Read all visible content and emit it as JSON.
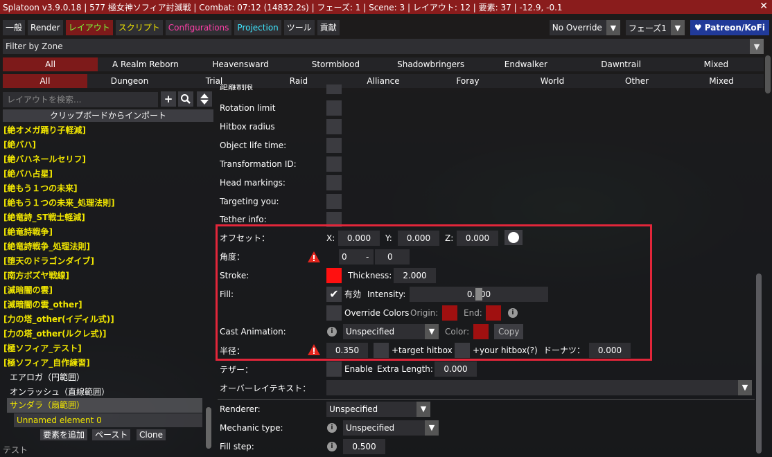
{
  "title": "Splatoon v3.9.0.18 | 577 極女神ソフィア討滅戦 | Combat: 07:12 (14832.2s) | フェーズ: 1 | Scene: 3 | レイアウト: 12 | 要素: 37 | -12.9, -0.1",
  "tabs": [
    {
      "label": "一般",
      "color": "#ffffff"
    },
    {
      "label": "Render",
      "color": "#ffffff"
    },
    {
      "label": "レイアウト",
      "color": "#7dff3a"
    },
    {
      "label": "スクリプト",
      "color": "#f1e600"
    },
    {
      "label": "Configurations",
      "color": "#ff3fa8"
    },
    {
      "label": "Projection",
      "color": "#3fe6ff"
    },
    {
      "label": "ツール",
      "color": "#ffffff"
    },
    {
      "label": "貢献",
      "color": "#ffffff"
    }
  ],
  "controls": {
    "override": "No Override",
    "phase": "フェーズ1",
    "patreon": "♥ Patreon/KoFi"
  },
  "filter": "Filter by Zone",
  "expansions": [
    "All",
    "A Realm Reborn",
    "Heavensward",
    "Stormblood",
    "Shadowbringers",
    "Endwalker",
    "Dawntrail",
    "Mixed"
  ],
  "content_types": [
    "All",
    "Dungeon",
    "Trial",
    "Raid",
    "Alliance",
    "Foray",
    "World",
    "Other",
    "Mixed"
  ],
  "left": {
    "search_placeholder": "レイアウトを検索...",
    "import_label": "クリップボードからインポート",
    "layouts": [
      "[絶オメガ踊り子軽減]",
      "[絶バハ]",
      "[絶バハネールセリフ]",
      "[絶バハ占星]",
      "[絶もう１つの未来]",
      "[絶もう１つの未来_処理法則]",
      "[絶竜詩_ST戦士軽減]",
      "[絶竜詩戦争]",
      "[絶竜詩戦争_処理法則]",
      "[堕天のドラゴンダイブ]",
      "[南方ボズヤ戦線]",
      "[滅暗闇の雲]",
      "[滅暗闇の雲_other]",
      "[力の塔_other(イディル式)]",
      "[力の塔_other(ルクレ式)]",
      "[極ソフィア_テスト]",
      "[極ソフィア_自作練習]"
    ],
    "subitems": [
      "エアロガ（円範囲）",
      "オンラッシュ（直線範囲）",
      "サンダラ（扇範囲）"
    ],
    "element": "Unnamed element 0",
    "buttons": {
      "add": "要素を追加",
      "paste": "ペースト",
      "clone": "Clone"
    },
    "footer": "テスト"
  },
  "right": {
    "partial_top": "距離制限",
    "rows_top": [
      "Rotation limit",
      "Hitbox radius",
      "Object life time:",
      "Transformation ID:",
      "Head markings:",
      "Targeting you:",
      "Tether info:"
    ],
    "offset": {
      "label": "オフセット：",
      "x_label": "X:",
      "x": "0.000",
      "y_label": "Y:",
      "y": "0.000",
      "z_label": "Z:",
      "z": "0.000"
    },
    "angle": {
      "label": "角度：",
      "from": "0",
      "dash": "-",
      "to": "0"
    },
    "stroke": {
      "label": "Stroke:",
      "color": "#ff1010",
      "thickness_label": "Thickness:",
      "thickness": "2.000"
    },
    "fill": {
      "label": "Fill:",
      "enabled_label": "有効",
      "intensity_label": "Intensity:",
      "intensity": "0.500"
    },
    "override": {
      "label": "Override Colors",
      "origin_label": "Origin:",
      "origin_color": "#a01010",
      "end_label": "End:",
      "end_color": "#a01010"
    },
    "cast": {
      "label": "Cast Animation:",
      "value": "Unspecified",
      "color_label": "Color:",
      "color": "#a01010",
      "copy": "Copy"
    },
    "radius": {
      "label": "半径：",
      "value": "0.350",
      "target_hitbox": "+target hitbox",
      "your_hitbox": "+your hitbox",
      "q": "(?)",
      "donut_label": "ドーナツ：",
      "donut": "0.000"
    },
    "tether": {
      "label": "テザー：",
      "enable": "Enable",
      "extra_label": "Extra Length:",
      "extra": "0.000"
    },
    "overlay": {
      "label": "オーバーレイテキスト："
    },
    "renderer": {
      "label": "Renderer:",
      "value": "Unspecified"
    },
    "mechanic": {
      "label": "Mechanic type:",
      "value": "Unspecified"
    },
    "fillstep": {
      "label": "Fill step:",
      "value": "0.500"
    }
  }
}
